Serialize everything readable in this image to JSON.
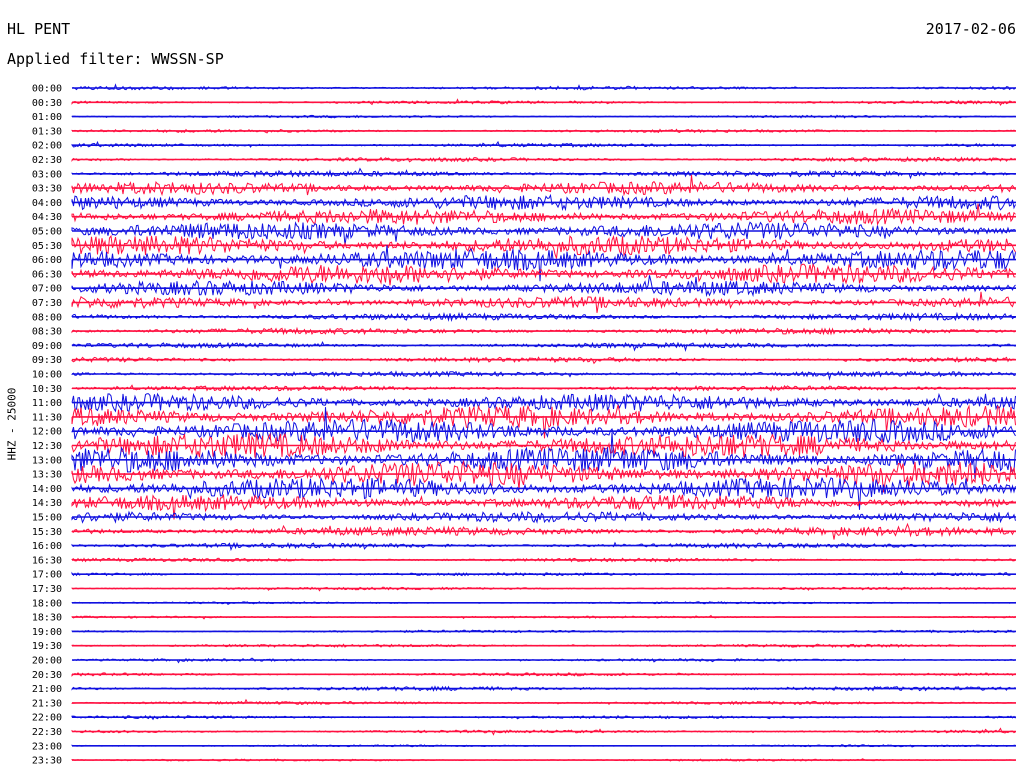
{
  "header": {
    "station": "HL PENT",
    "date": "2017-02-06",
    "filter": "Applied filter: WWSSN-SP"
  },
  "colors": {
    "trace_a": "#1010e0",
    "trace_b": "#ff1040"
  },
  "chart_data": {
    "type": "line",
    "title": "HL PENT",
    "subtitle": "Applied filter: WWSSN-SP",
    "date": "2017-02-06",
    "ylabel": "HHZ - 25000",
    "trace_colors_alternate": [
      "blue",
      "red"
    ],
    "row_labels": [
      "00:00",
      "00:30",
      "01:00",
      "01:30",
      "02:00",
      "02:30",
      "03:00",
      "03:30",
      "04:00",
      "04:30",
      "05:00",
      "05:30",
      "06:00",
      "06:30",
      "07:00",
      "07:30",
      "08:00",
      "08:30",
      "09:00",
      "09:30",
      "10:00",
      "10:30",
      "11:00",
      "11:30",
      "12:00",
      "12:30",
      "13:00",
      "13:30",
      "14:00",
      "14:30",
      "15:00",
      "15:30",
      "16:00",
      "16:30",
      "17:00",
      "17:30",
      "18:00",
      "18:30",
      "19:00",
      "19:30",
      "20:00",
      "20:30",
      "21:00",
      "21:30",
      "22:00",
      "22:30",
      "23:00",
      "23:30"
    ],
    "activity_level": [
      0.35,
      0.3,
      0.25,
      0.3,
      0.35,
      0.4,
      0.6,
      1.3,
      1.5,
      1.6,
      1.8,
      2.0,
      2.2,
      2.0,
      1.5,
      1.2,
      0.7,
      0.6,
      0.5,
      0.5,
      0.5,
      0.5,
      1.8,
      2.2,
      2.4,
      2.5,
      2.6,
      2.5,
      2.2,
      1.6,
      1.1,
      0.9,
      0.5,
      0.35,
      0.3,
      0.25,
      0.2,
      0.2,
      0.25,
      0.3,
      0.25,
      0.3,
      0.4,
      0.3,
      0.3,
      0.3,
      0.2,
      0.2
    ]
  }
}
